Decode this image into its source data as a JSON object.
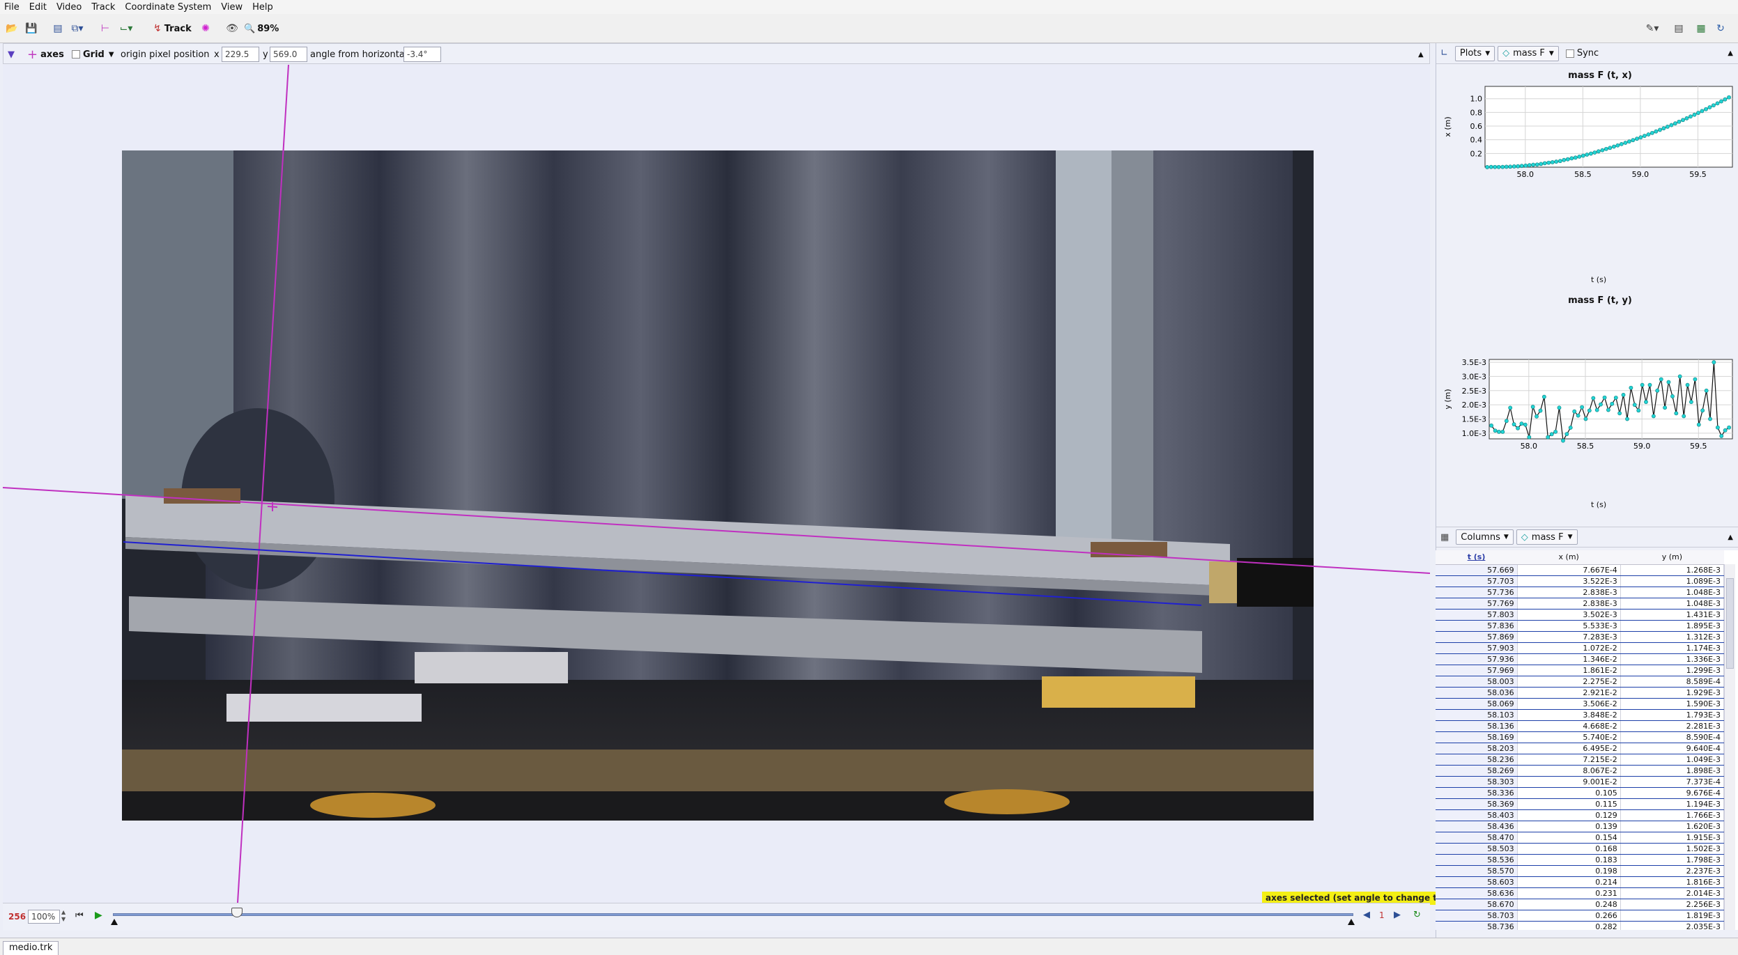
{
  "menu": [
    "File",
    "Edit",
    "Video",
    "Track",
    "Coordinate System",
    "View",
    "Help"
  ],
  "toolbar": {
    "track_label": "Track",
    "zoom": "89%"
  },
  "axesbar": {
    "axes_label": "axes",
    "grid_label": "Grid",
    "origin_label": "origin pixel position",
    "x_label": "x",
    "x_value": "229.5",
    "y_label": "y",
    "y_value": "569.0",
    "angle_label": "angle from horizontal",
    "angle_value": "-3.4°"
  },
  "status_message": "axes selected (set angle to change tilt)",
  "player": {
    "frame": "256",
    "rate": "100%",
    "step": "1"
  },
  "file_tab": "medio.trk",
  "plots_panel": {
    "plots_label": "Plots",
    "track_label": "mass F",
    "sync_label": "Sync"
  },
  "plot1": {
    "title": "mass F (t, x)",
    "xlabel": "t (s)",
    "ylabel": "x (m)",
    "xticks": [
      "58.0",
      "58.5",
      "59.0",
      "59.5"
    ],
    "yticks": [
      "0.2",
      "0.4",
      "0.6",
      "0.8",
      "1.0"
    ]
  },
  "plot2": {
    "title": "mass F (t, y)",
    "xlabel": "t (s)",
    "ylabel": "y (m)",
    "xticks": [
      "58.0",
      "58.5",
      "59.0",
      "59.5"
    ],
    "yticks": [
      "1.0E-3",
      "1.5E-3",
      "2.0E-3",
      "2.5E-3",
      "3.0E-3",
      "3.5E-3"
    ]
  },
  "table_panel": {
    "columns_label": "Columns",
    "track_label": "mass F"
  },
  "table": {
    "headers": [
      "t (s)",
      "x (m)",
      "y (m)"
    ],
    "rows": [
      [
        "57.669",
        "7.667E-4",
        "1.268E-3"
      ],
      [
        "57.703",
        "3.522E-3",
        "1.089E-3"
      ],
      [
        "57.736",
        "2.838E-3",
        "1.048E-3"
      ],
      [
        "57.769",
        "2.838E-3",
        "1.048E-3"
      ],
      [
        "57.803",
        "3.502E-3",
        "1.431E-3"
      ],
      [
        "57.836",
        "5.533E-3",
        "1.895E-3"
      ],
      [
        "57.869",
        "7.283E-3",
        "1.312E-3"
      ],
      [
        "57.903",
        "1.072E-2",
        "1.174E-3"
      ],
      [
        "57.936",
        "1.346E-2",
        "1.336E-3"
      ],
      [
        "57.969",
        "1.861E-2",
        "1.299E-3"
      ],
      [
        "58.003",
        "2.275E-2",
        "8.589E-4"
      ],
      [
        "58.036",
        "2.921E-2",
        "1.929E-3"
      ],
      [
        "58.069",
        "3.506E-2",
        "1.590E-3"
      ],
      [
        "58.103",
        "3.848E-2",
        "1.793E-3"
      ],
      [
        "58.136",
        "4.668E-2",
        "2.281E-3"
      ],
      [
        "58.169",
        "5.740E-2",
        "8.590E-4"
      ],
      [
        "58.203",
        "6.495E-2",
        "9.640E-4"
      ],
      [
        "58.236",
        "7.215E-2",
        "1.049E-3"
      ],
      [
        "58.269",
        "8.067E-2",
        "1.898E-3"
      ],
      [
        "58.303",
        "9.001E-2",
        "7.373E-4"
      ],
      [
        "58.336",
        "0.105",
        "9.676E-4"
      ],
      [
        "58.369",
        "0.115",
        "1.194E-3"
      ],
      [
        "58.403",
        "0.129",
        "1.766E-3"
      ],
      [
        "58.436",
        "0.139",
        "1.620E-3"
      ],
      [
        "58.470",
        "0.154",
        "1.915E-3"
      ],
      [
        "58.503",
        "0.168",
        "1.502E-3"
      ],
      [
        "58.536",
        "0.183",
        "1.798E-3"
      ],
      [
        "58.570",
        "0.198",
        "2.237E-3"
      ],
      [
        "58.603",
        "0.214",
        "1.816E-3"
      ],
      [
        "58.636",
        "0.231",
        "2.014E-3"
      ],
      [
        "58.670",
        "0.248",
        "2.256E-3"
      ],
      [
        "58.703",
        "0.266",
        "1.819E-3"
      ],
      [
        "58.736",
        "0.282",
        "2.035E-3"
      ]
    ]
  },
  "chart_data": [
    {
      "type": "line",
      "title": "mass F (t, x)",
      "xlabel": "t (s)",
      "ylabel": "x (m)",
      "xlim": [
        57.65,
        59.8
      ],
      "ylim": [
        0,
        1.18
      ],
      "series": [
        {
          "x": [
            57.669,
            57.703,
            57.736,
            57.769,
            57.803,
            57.836,
            57.869,
            57.903,
            57.936,
            57.969,
            58.003,
            58.036,
            58.069,
            58.103,
            58.136,
            58.169,
            58.203,
            58.236,
            58.269,
            58.303,
            58.336,
            58.369,
            58.403,
            58.436,
            58.47,
            58.503,
            58.536,
            58.57,
            58.603,
            58.636,
            58.67,
            58.703,
            58.736,
            58.77,
            58.803,
            58.836,
            58.87,
            58.903,
            58.936,
            58.97,
            59.003,
            59.036,
            59.07,
            59.103,
            59.136,
            59.17,
            59.203,
            59.236,
            59.27,
            59.303,
            59.336,
            59.37,
            59.403,
            59.436,
            59.47,
            59.503,
            59.536,
            59.57,
            59.603,
            59.636,
            59.67,
            59.703,
            59.736,
            59.77
          ],
          "y": [
            0.0008,
            0.0035,
            0.0028,
            0.0028,
            0.0035,
            0.0055,
            0.0073,
            0.0107,
            0.0135,
            0.0186,
            0.0228,
            0.0292,
            0.0351,
            0.0385,
            0.0467,
            0.0574,
            0.065,
            0.0722,
            0.0807,
            0.09,
            0.105,
            0.115,
            0.129,
            0.139,
            0.154,
            0.168,
            0.183,
            0.198,
            0.214,
            0.231,
            0.248,
            0.266,
            0.282,
            0.3,
            0.318,
            0.337,
            0.356,
            0.375,
            0.395,
            0.415,
            0.436,
            0.457,
            0.478,
            0.5,
            0.522,
            0.545,
            0.568,
            0.591,
            0.615,
            0.639,
            0.664,
            0.689,
            0.714,
            0.74,
            0.766,
            0.793,
            0.82,
            0.847,
            0.875,
            0.903,
            0.932,
            0.961,
            0.99,
            1.02
          ]
        }
      ]
    },
    {
      "type": "line",
      "title": "mass F (t, y)",
      "xlabel": "t (s)",
      "ylabel": "y (m)",
      "xlim": [
        57.65,
        59.8
      ],
      "ylim": [
        0.0008,
        0.0036
      ],
      "series": [
        {
          "x": [
            57.669,
            57.703,
            57.736,
            57.769,
            57.803,
            57.836,
            57.869,
            57.903,
            57.936,
            57.969,
            58.003,
            58.036,
            58.069,
            58.103,
            58.136,
            58.169,
            58.203,
            58.236,
            58.269,
            58.303,
            58.336,
            58.369,
            58.403,
            58.436,
            58.47,
            58.503,
            58.536,
            58.57,
            58.603,
            58.636,
            58.67,
            58.703,
            58.736,
            58.77,
            58.803,
            58.836,
            58.87,
            58.903,
            58.936,
            58.97,
            59.003,
            59.036,
            59.07,
            59.103,
            59.136,
            59.17,
            59.203,
            59.236,
            59.27,
            59.303,
            59.336,
            59.37,
            59.403,
            59.436,
            59.47,
            59.503,
            59.536,
            59.57,
            59.603,
            59.636,
            59.67,
            59.703,
            59.736,
            59.77
          ],
          "y": [
            0.001268,
            0.001089,
            0.001048,
            0.001048,
            0.001431,
            0.001895,
            0.001312,
            0.001174,
            0.001336,
            0.001299,
            0.000859,
            0.001929,
            0.00159,
            0.001793,
            0.002281,
            0.000859,
            0.000964,
            0.001049,
            0.001898,
            0.000737,
            0.000968,
            0.001194,
            0.001766,
            0.00162,
            0.001915,
            0.001502,
            0.001798,
            0.002237,
            0.001816,
            0.002014,
            0.002256,
            0.001819,
            0.002035,
            0.00225,
            0.0017,
            0.00235,
            0.0015,
            0.0026,
            0.002,
            0.0018,
            0.0027,
            0.0021,
            0.0027,
            0.0016,
            0.0025,
            0.0029,
            0.0019,
            0.0028,
            0.0023,
            0.0017,
            0.003,
            0.0016,
            0.0027,
            0.0021,
            0.0029,
            0.0013,
            0.0018,
            0.0025,
            0.0015,
            0.0035,
            0.0012,
            0.0009,
            0.0011,
            0.0012
          ]
        }
      ]
    }
  ]
}
